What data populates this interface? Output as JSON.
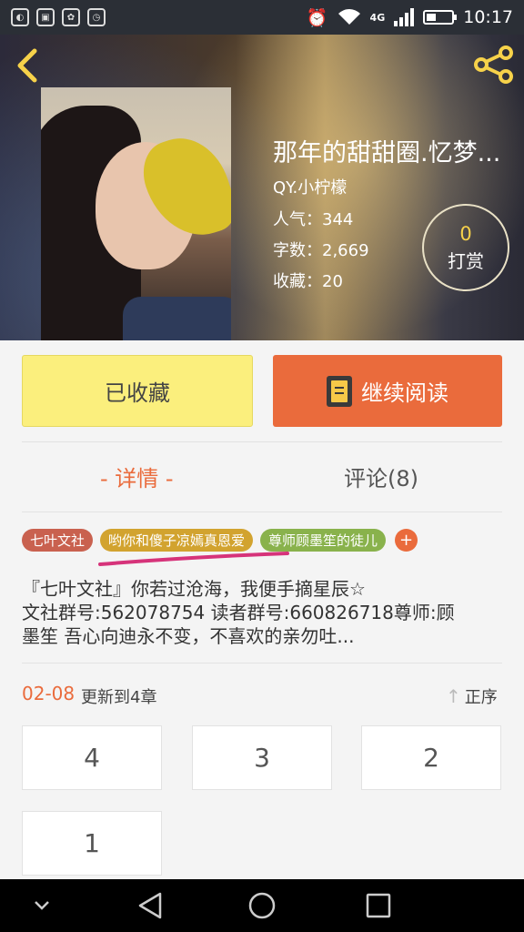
{
  "status_bar": {
    "app_icons": [
      "browser-icon",
      "box-icon",
      "huawei-icon",
      "clock-app-icon"
    ],
    "network": "4G",
    "battery_level": 0.35,
    "time": "10:17"
  },
  "book": {
    "title": "那年的甜甜圈.忆梦...",
    "author": "QY.小柠檬",
    "stats": {
      "popularity": "人气：344",
      "words": "字数：2,669",
      "favorites": "收藏：20"
    },
    "reward": {
      "count": "0",
      "label": "打赏"
    }
  },
  "actions": {
    "collected": "已收藏",
    "continue_reading": "继续阅读"
  },
  "tabs": {
    "detail": "- 详情 -",
    "comments": "评论(8)"
  },
  "tags": [
    "七叶文社",
    "哟你和傻子凉嫣真恩爱",
    "尊师顾墨笙的徒儿"
  ],
  "tag_add": "+",
  "description": {
    "line1": "『七叶文社』你若过沧海，我便手摘星辰☆",
    "line2": "文社群号:562078754  读者群号:660826718尊师:顾",
    "line3": "墨笙          吾心向迪永不变，不喜欢的亲勿吐..."
  },
  "chapters": {
    "update_date": "02-08",
    "update_text": "更新到4章",
    "sort_label": "正序",
    "items": [
      "4",
      "3",
      "2",
      "1"
    ]
  },
  "colors": {
    "accent": "#ea6b3c",
    "collected_bg": "#fbef7d",
    "tag_1": "#c9614f",
    "tag_2": "#d2a32f",
    "tag_3": "#89b24c"
  }
}
